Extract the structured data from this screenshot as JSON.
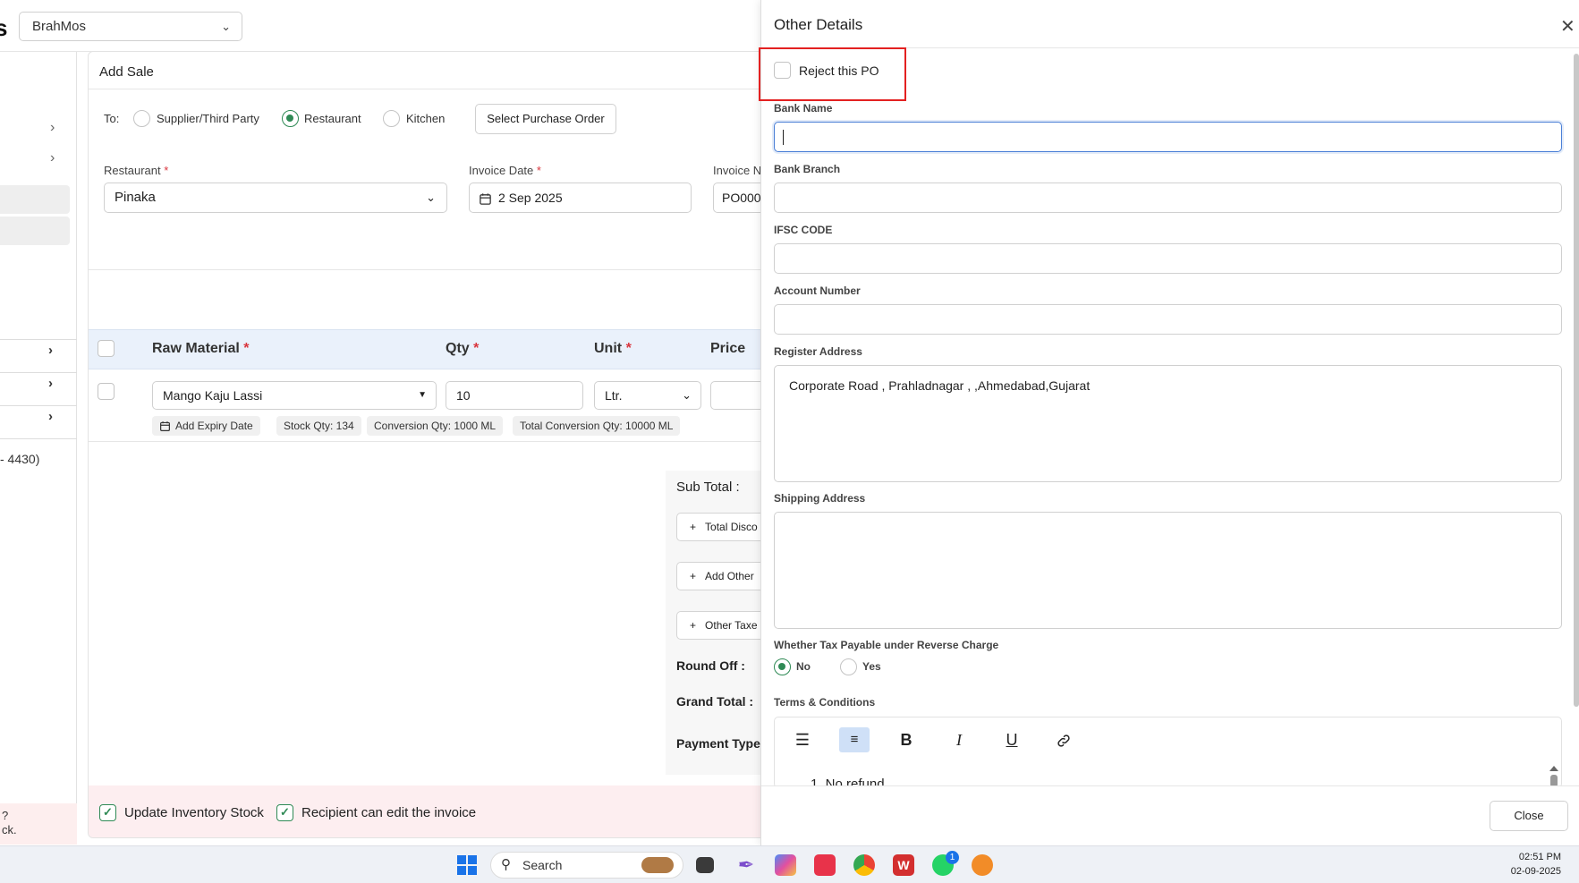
{
  "header": {
    "app_letter": "s",
    "outlet_selected": "BrahMos"
  },
  "sidebar": {
    "fragment_number": "- 4430)",
    "footer_line1": "?",
    "footer_line2": "ck."
  },
  "add_sale": {
    "title": "Add Sale",
    "to_label": "To:",
    "to_options": [
      "Supplier/Third Party",
      "Restaurant",
      "Kitchen"
    ],
    "to_selected": "Restaurant",
    "select_po_button": "Select Purchase Order",
    "restaurant_label": "Restaurant",
    "restaurant_value": "Pinaka",
    "invoice_date_label": "Invoice Date",
    "invoice_date_value": "2 Sep 2025",
    "invoice_no_label": "Invoice N",
    "invoice_no_value": "PO000",
    "required_mark": "*"
  },
  "table": {
    "headers": {
      "raw_material": "Raw Material",
      "qty": "Qty",
      "unit": "Unit",
      "price": "Price"
    },
    "row": {
      "material": "Mango Kaju Lassi",
      "qty": "10",
      "unit": "Ltr.",
      "add_expiry": "Add Expiry Date",
      "stock_qty": "Stock Qty: 134",
      "conversion_qty": "Conversion Qty: 1000 ML",
      "total_conversion_qty": "Total Conversion Qty: 10000 ML"
    }
  },
  "totals": {
    "sub_total": "Sub Total :",
    "total_discount": "Total Disco",
    "add_other": "Add Other",
    "other_taxes": "Other Taxe",
    "round_off": "Round Off :",
    "grand_total": "Grand Total :",
    "payment_type": "Payment Type"
  },
  "footer": {
    "update_inventory": "Update Inventory Stock",
    "recipient_edit": "Recipient can edit the invoice"
  },
  "panel": {
    "title": "Other Details",
    "reject_po": "Reject this PO",
    "bank_name_label": "Bank Name",
    "bank_name_value": "",
    "bank_branch_label": "Bank Branch",
    "ifsc_label": "IFSC CODE",
    "account_number_label": "Account Number",
    "register_address_label": "Register Address",
    "register_address_value": "Corporate Road , Prahladnagar , ,Ahmedabad,Gujarat",
    "shipping_address_label": "Shipping Address",
    "shipping_address_value": "",
    "reverse_charge_label": "Whether Tax Payable under Reverse Charge",
    "reverse_charge_options": [
      "No",
      "Yes"
    ],
    "reverse_charge_selected": "No",
    "terms_label": "Terms & Conditions",
    "terms_first_line": "1. No refund",
    "close_button": "Close"
  },
  "taskbar": {
    "search_placeholder": "Search",
    "whatsapp_badge": "1",
    "time": "02:51 PM",
    "date": "02-09-2025"
  },
  "colors": {
    "accent_green": "#2f8a55",
    "highlight_red": "#e32121",
    "focus_blue": "#4a7fd6",
    "table_header_bg": "#eaf1fb"
  }
}
